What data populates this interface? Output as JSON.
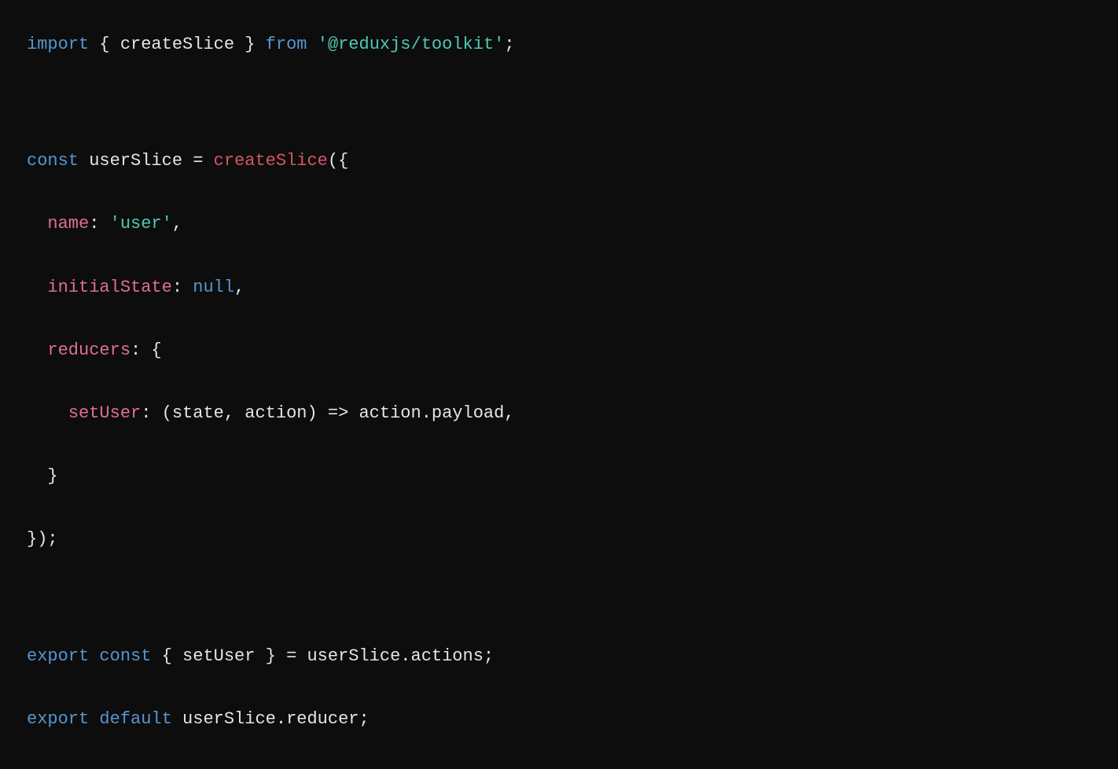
{
  "code": {
    "l1": {
      "import_kw": "import",
      "braces_open": " { ",
      "createSlice": "createSlice",
      "braces_close": " } ",
      "from_kw": "from",
      "space": " ",
      "module": "'@reduxjs/toolkit'",
      "semi": ";"
    },
    "l3": {
      "const_kw": "const",
      "var_assign": " userSlice = ",
      "fn": "createSlice",
      "paren": "({"
    },
    "l4": {
      "indent": "  ",
      "key": "name",
      "colon": ": ",
      "val": "'user'",
      "comma": ","
    },
    "l5": {
      "indent": "  ",
      "key": "initialState",
      "colon": ": ",
      "val": "null",
      "comma": ","
    },
    "l6": {
      "indent": "  ",
      "key": "reducers",
      "rest": ": {"
    },
    "l7": {
      "indent": "    ",
      "key": "setUser",
      "rest": ": (state, action) => action.payload,"
    },
    "l8": {
      "text": "  }"
    },
    "l9": {
      "text": "});"
    },
    "l11": {
      "export_kw": "export",
      "space1": " ",
      "const_kw": "const",
      "rest": " { setUser } = userSlice.actions;"
    },
    "l12": {
      "export_kw": "export",
      "space1": " ",
      "default_kw": "default",
      "rest": " userSlice.reducer;"
    }
  }
}
